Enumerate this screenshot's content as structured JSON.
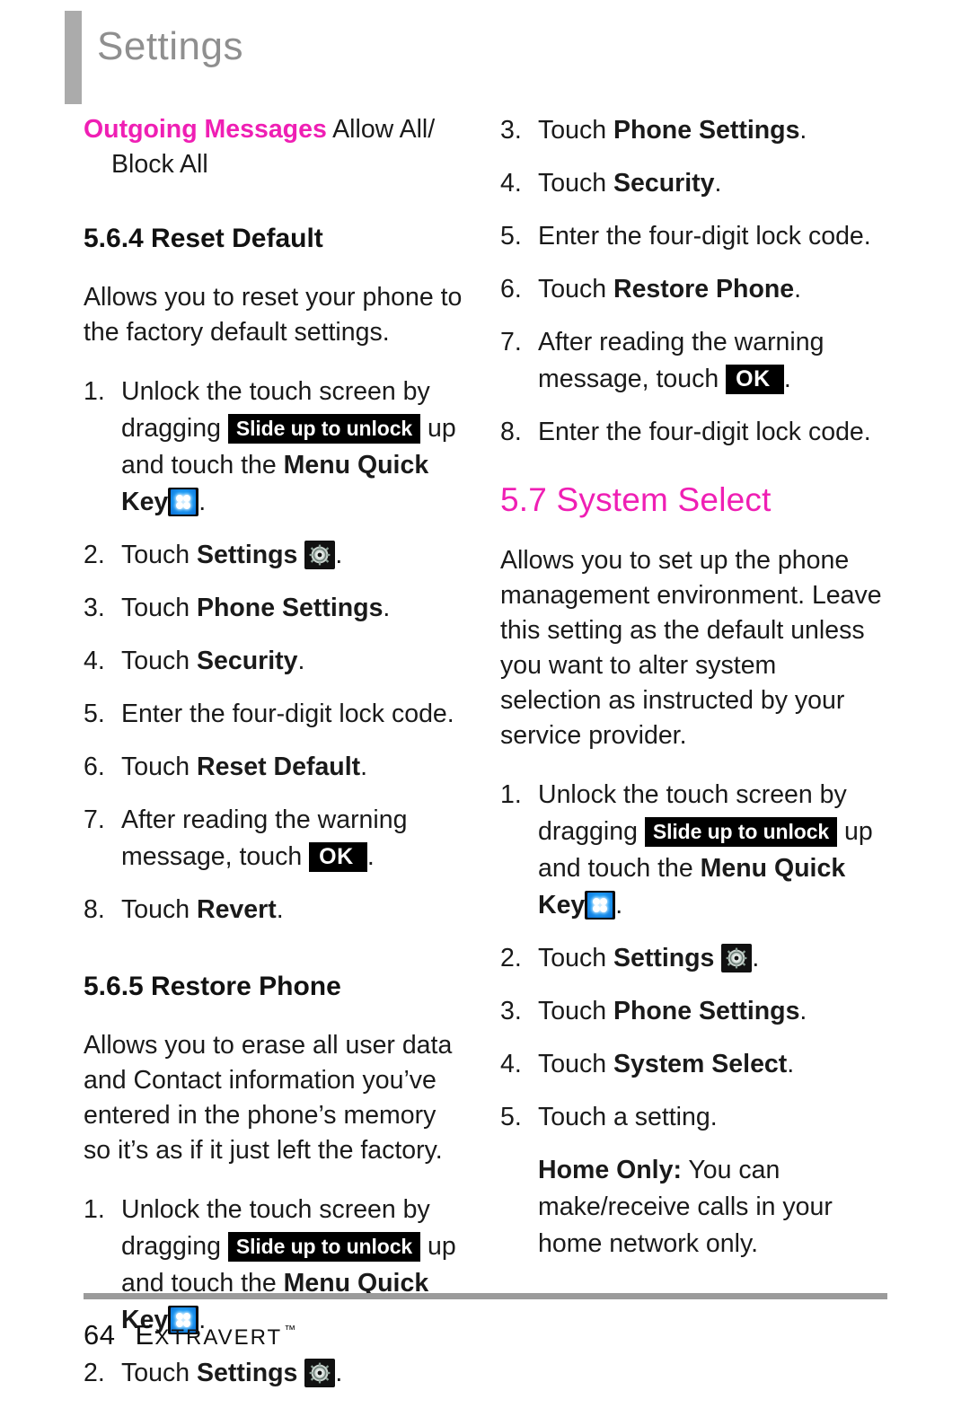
{
  "header": {
    "title": "Settings"
  },
  "colors": {
    "accent_magenta": "#ef1fb4",
    "header_gray": "#8f8f8f",
    "rule_gray": "#9b9b9b",
    "badge_black": "#000000",
    "menu_key_blue": "#1e9cf5"
  },
  "icons": {
    "menu_quick_key": "menu-quick-key-icon",
    "settings_gear": "settings-gear-icon"
  },
  "badges": {
    "slide_up_to_unlock": "Slide up to unlock",
    "ok": "OK"
  },
  "left_column": {
    "note": {
      "term": "Outgoing Messages",
      "definition": " Allow All/ Block All"
    },
    "section_reset_default": {
      "heading": "5.6.4 Reset Default",
      "intro": "Allows you to reset your phone to the factory default settings.",
      "steps": [
        {
          "num": "1.",
          "parts": {
            "a": "Unlock the touch screen by dragging ",
            "b": " up and touch the ",
            "c": "Menu Quick Key",
            "d": "."
          }
        },
        {
          "num": "2.",
          "parts": {
            "a": "Touch ",
            "b": "Settings",
            "c": "."
          }
        },
        {
          "num": "3.",
          "parts": {
            "a": "Touch ",
            "b": "Phone Settings",
            "c": "."
          }
        },
        {
          "num": "4.",
          "parts": {
            "a": "Touch ",
            "b": "Security",
            "c": "."
          }
        },
        {
          "num": "5.",
          "parts": {
            "a": "Enter the four-digit lock code."
          }
        },
        {
          "num": "6.",
          "parts": {
            "a": "Touch ",
            "b": "Reset Default",
            "c": "."
          }
        },
        {
          "num": "7.",
          "parts": {
            "a": "After reading the warning message, touch ",
            "b": "."
          }
        },
        {
          "num": "8.",
          "parts": {
            "a": "Touch ",
            "b": "Revert",
            "c": "."
          }
        }
      ]
    },
    "section_restore_phone": {
      "heading": "5.6.5 Restore Phone",
      "intro": "Allows you to erase all user data and Contact information you’ve entered in the phone’s memory so it’s as if it just left the factory.",
      "steps": [
        {
          "num": "1.",
          "parts": {
            "a": "Unlock the touch screen by dragging ",
            "b": " up and touch the ",
            "c": "Menu Quick Key",
            "d": "."
          }
        },
        {
          "num": "2.",
          "parts": {
            "a": "Touch ",
            "b": "Settings",
            "c": "."
          }
        }
      ]
    }
  },
  "right_column": {
    "continued_steps": [
      {
        "num": "3.",
        "parts": {
          "a": "Touch ",
          "b": "Phone Settings",
          "c": "."
        }
      },
      {
        "num": "4.",
        "parts": {
          "a": "Touch ",
          "b": "Security",
          "c": "."
        }
      },
      {
        "num": "5.",
        "parts": {
          "a": "Enter the four-digit lock code."
        }
      },
      {
        "num": "6.",
        "parts": {
          "a": "Touch ",
          "b": "Restore Phone",
          "c": "."
        }
      },
      {
        "num": "7.",
        "parts": {
          "a": "After reading the warning message, touch ",
          "b": "."
        }
      },
      {
        "num": "8.",
        "parts": {
          "a": "Enter the four-digit lock code."
        }
      }
    ],
    "section_system_select": {
      "heading": "5.7 System Select",
      "intro": "Allows you to set up the phone management environment. Leave this setting as the default unless you want to alter system selection as instructed by your service provider.",
      "steps": [
        {
          "num": "1.",
          "parts": {
            "a": "Unlock the touch screen by dragging ",
            "b": " up and touch the ",
            "c": "Menu Quick Key",
            "d": "."
          }
        },
        {
          "num": "2.",
          "parts": {
            "a": "Touch ",
            "b": "Settings",
            "c": "."
          }
        },
        {
          "num": "3.",
          "parts": {
            "a": "Touch ",
            "b": "Phone Settings",
            "c": "."
          }
        },
        {
          "num": "4.",
          "parts": {
            "a": "Touch ",
            "b": "System Select",
            "c": "."
          }
        },
        {
          "num": "5.",
          "parts": {
            "a": "Touch a setting."
          }
        }
      ],
      "note": {
        "term": "Home Only:",
        "text": " You can make/receive calls in your home network only."
      }
    }
  },
  "footer": {
    "page_number": "64",
    "brand_first_letter": "E",
    "brand_rest": "XTRAVERT",
    "trademark": "™"
  }
}
